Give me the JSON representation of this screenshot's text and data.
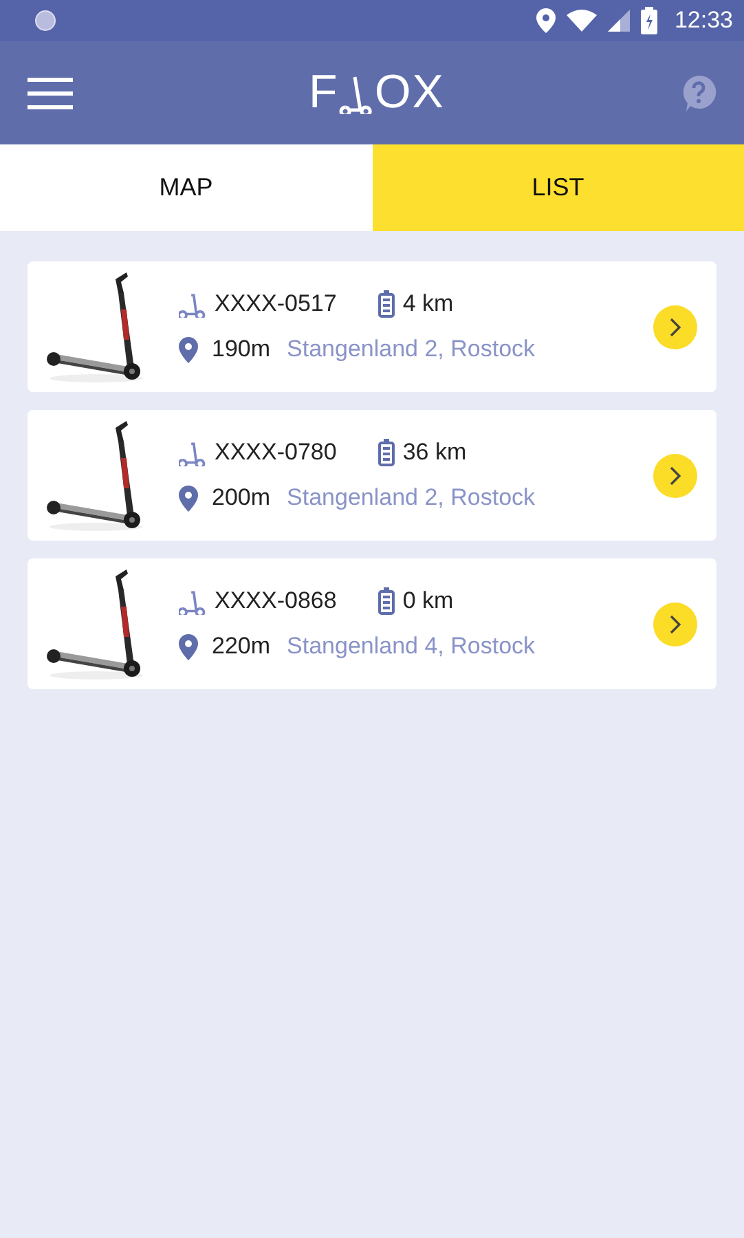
{
  "status_bar": {
    "time": "12:33"
  },
  "app_bar": {
    "logo": {
      "before": "F",
      "after": "OX"
    }
  },
  "tabs": [
    {
      "label": "MAP",
      "selected": false
    },
    {
      "label": "LIST",
      "selected": true
    }
  ],
  "scooters": [
    {
      "id": "XXXX-0517",
      "range": "4 km",
      "distance": "190m",
      "address": "Stangenland 2, Rostock"
    },
    {
      "id": "XXXX-0780",
      "range": "36 km",
      "distance": "200m",
      "address": "Stangenland 2, Rostock"
    },
    {
      "id": "XXXX-0868",
      "range": "0 km",
      "distance": "220m",
      "address": "Stangenland 4, Rostock"
    }
  ]
}
